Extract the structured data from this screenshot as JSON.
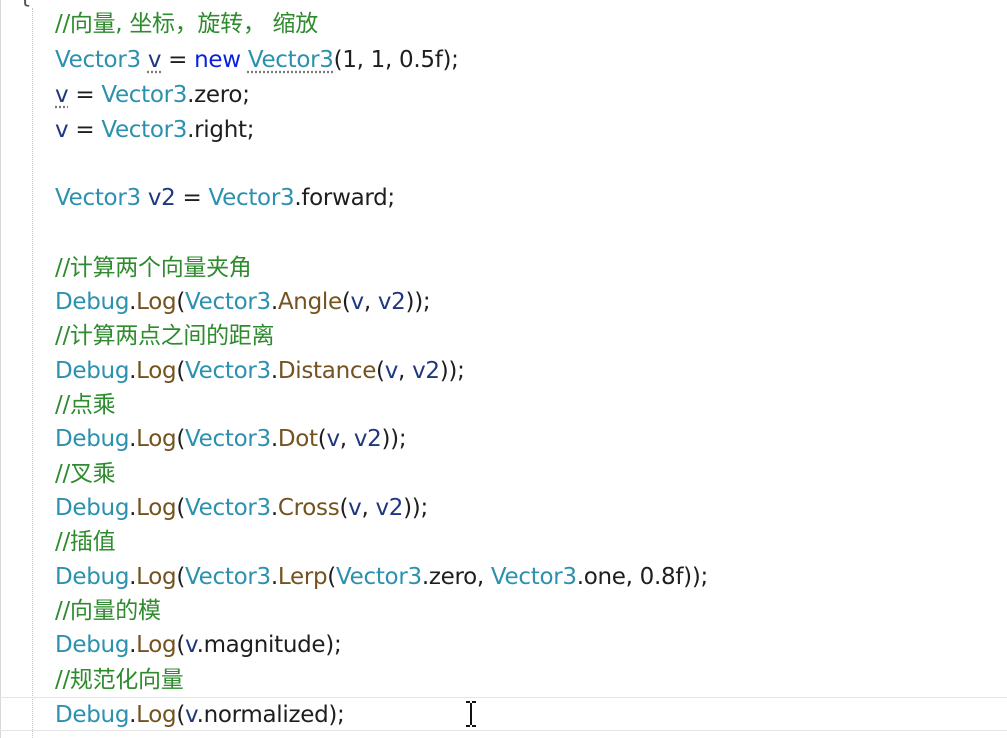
{
  "editor": {
    "brace": "{",
    "lines": {
      "l1": {
        "comment": "//向量, 坐标，旋转， 缩放"
      },
      "l2": {
        "t1": "Vector3",
        "v": "v",
        "eq": " = ",
        "kw": "new",
        "t2": "Vector3",
        "rest": "(1, 1, 0.5f);"
      },
      "l3": {
        "v": "v",
        "eq": " = ",
        "t": "Vector3",
        "rest": ".zero;"
      },
      "l4": {
        "v": "v",
        "eq": " = ",
        "t": "Vector3",
        "rest": ".right;"
      },
      "l5": {
        "t1": "Vector3",
        "v": "v2",
        "eq": " = ",
        "t2": "Vector3",
        "rest": ".forward;"
      },
      "l6": {
        "comment": "//计算两个向量夹角"
      },
      "l7": {
        "cls": "Debug",
        "dot": ".",
        "m": "Log",
        "p": "(",
        "t": "Vector3",
        "dot2": ".",
        "m2": "Angle",
        "p2": "(",
        "a1": "v",
        "sep": ", ",
        "a2": "v2",
        "end": "));"
      },
      "l8": {
        "comment": "//计算两点之间的距离"
      },
      "l9": {
        "cls": "Debug",
        "dot": ".",
        "m": "Log",
        "p": "(",
        "t": "Vector3",
        "dot2": ".",
        "m2": "Distance",
        "p2": "(",
        "a1": "v",
        "sep": ", ",
        "a2": "v2",
        "end": "));"
      },
      "l10": {
        "comment": "//点乘"
      },
      "l11": {
        "cls": "Debug",
        "dot": ".",
        "m": "Log",
        "p": "(",
        "t": "Vector3",
        "dot2": ".",
        "m2": "Dot",
        "p2": "(",
        "a1": "v",
        "sep": ", ",
        "a2": "v2",
        "end": "));"
      },
      "l12": {
        "comment": "//叉乘"
      },
      "l13": {
        "cls": "Debug",
        "dot": ".",
        "m": "Log",
        "p": "(",
        "t": "Vector3",
        "dot2": ".",
        "m2": "Cross",
        "p2": "(",
        "a1": "v",
        "sep": ", ",
        "a2": "v2",
        "end": "));"
      },
      "l14": {
        "comment": "//插值"
      },
      "l15": {
        "cls": "Debug",
        "dot": ".",
        "m": "Log",
        "p": "(",
        "t": "Vector3",
        "dot2": ".",
        "m2": "Lerp",
        "p2": "(",
        "t2": "Vector3",
        "r2": ".zero, ",
        "t3": "Vector3",
        "r3": ".one, 0.8f));"
      },
      "l16": {
        "comment": "//向量的模"
      },
      "l17": {
        "cls": "Debug",
        "dot": ".",
        "m": "Log",
        "p": "(",
        "a1": "v",
        "rest": ".magnitude);"
      },
      "l18": {
        "comment": "//规范化向量"
      },
      "l19": {
        "cls": "Debug",
        "dot": ".",
        "m": "Log",
        "p": "(",
        "a1": "v",
        "rest": ".normalized);"
      }
    }
  }
}
